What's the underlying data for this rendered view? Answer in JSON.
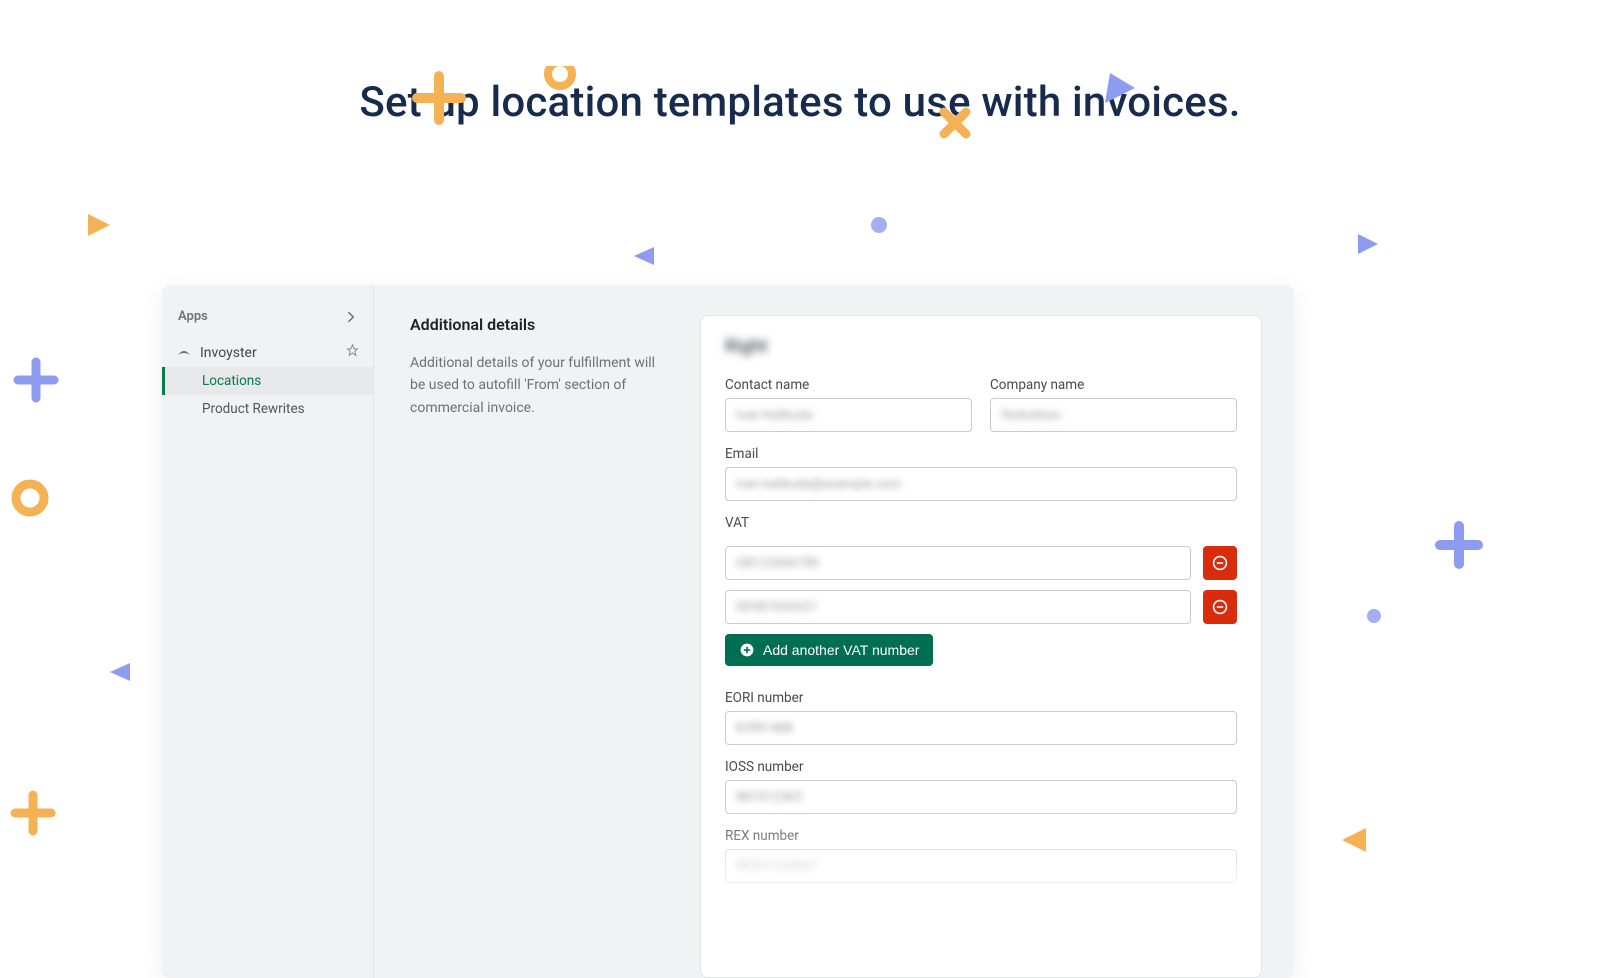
{
  "hero_title": "Set up location templates to use with invoices.",
  "sidebar": {
    "header": "Apps",
    "app_name": "Invoyster",
    "items": [
      {
        "label": "Locations",
        "active": true
      },
      {
        "label": "Product Rewrites",
        "active": false
      }
    ]
  },
  "intro": {
    "title": "Additional details",
    "body": "Additional details of your fulfillment will be used to autofill 'From' section of commercial invoice."
  },
  "form": {
    "card_title_blur": "Right",
    "contact_label": "Contact name",
    "company_label": "Company name",
    "email_label": "Email",
    "vat_label": "VAT",
    "add_vat_label": "Add another VAT number",
    "eori_label": "EORI number",
    "ioss_label": "IOSS number",
    "rex_label": "REX number"
  }
}
